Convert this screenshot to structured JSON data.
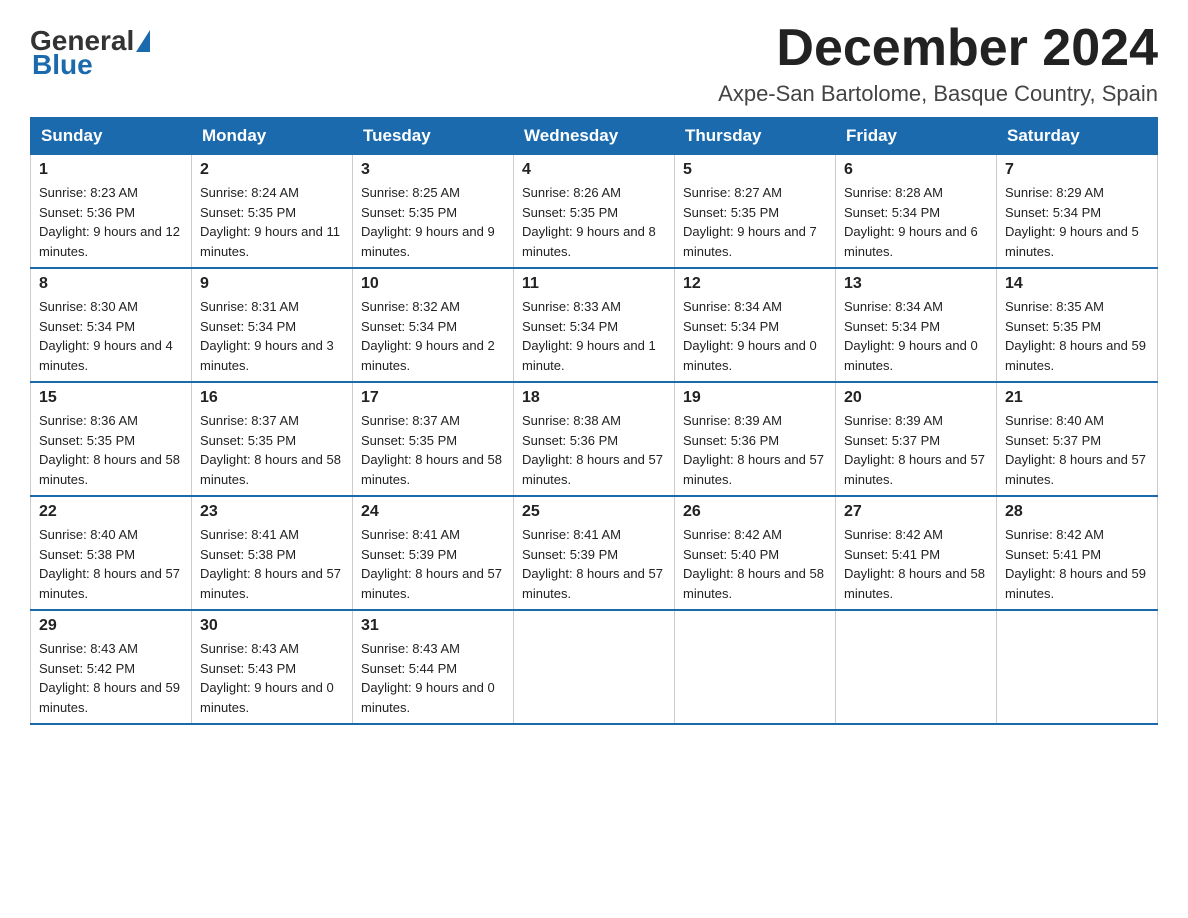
{
  "logo": {
    "general": "General",
    "blue": "Blue"
  },
  "header": {
    "title": "December 2024",
    "location": "Axpe-San Bartolome, Basque Country, Spain"
  },
  "days_of_week": [
    "Sunday",
    "Monday",
    "Tuesday",
    "Wednesday",
    "Thursday",
    "Friday",
    "Saturday"
  ],
  "weeks": [
    [
      {
        "day": "1",
        "sunrise": "8:23 AM",
        "sunset": "5:36 PM",
        "daylight": "9 hours and 12 minutes."
      },
      {
        "day": "2",
        "sunrise": "8:24 AM",
        "sunset": "5:35 PM",
        "daylight": "9 hours and 11 minutes."
      },
      {
        "day": "3",
        "sunrise": "8:25 AM",
        "sunset": "5:35 PM",
        "daylight": "9 hours and 9 minutes."
      },
      {
        "day": "4",
        "sunrise": "8:26 AM",
        "sunset": "5:35 PM",
        "daylight": "9 hours and 8 minutes."
      },
      {
        "day": "5",
        "sunrise": "8:27 AM",
        "sunset": "5:35 PM",
        "daylight": "9 hours and 7 minutes."
      },
      {
        "day": "6",
        "sunrise": "8:28 AM",
        "sunset": "5:34 PM",
        "daylight": "9 hours and 6 minutes."
      },
      {
        "day": "7",
        "sunrise": "8:29 AM",
        "sunset": "5:34 PM",
        "daylight": "9 hours and 5 minutes."
      }
    ],
    [
      {
        "day": "8",
        "sunrise": "8:30 AM",
        "sunset": "5:34 PM",
        "daylight": "9 hours and 4 minutes."
      },
      {
        "day": "9",
        "sunrise": "8:31 AM",
        "sunset": "5:34 PM",
        "daylight": "9 hours and 3 minutes."
      },
      {
        "day": "10",
        "sunrise": "8:32 AM",
        "sunset": "5:34 PM",
        "daylight": "9 hours and 2 minutes."
      },
      {
        "day": "11",
        "sunrise": "8:33 AM",
        "sunset": "5:34 PM",
        "daylight": "9 hours and 1 minute."
      },
      {
        "day": "12",
        "sunrise": "8:34 AM",
        "sunset": "5:34 PM",
        "daylight": "9 hours and 0 minutes."
      },
      {
        "day": "13",
        "sunrise": "8:34 AM",
        "sunset": "5:34 PM",
        "daylight": "9 hours and 0 minutes."
      },
      {
        "day": "14",
        "sunrise": "8:35 AM",
        "sunset": "5:35 PM",
        "daylight": "8 hours and 59 minutes."
      }
    ],
    [
      {
        "day": "15",
        "sunrise": "8:36 AM",
        "sunset": "5:35 PM",
        "daylight": "8 hours and 58 minutes."
      },
      {
        "day": "16",
        "sunrise": "8:37 AM",
        "sunset": "5:35 PM",
        "daylight": "8 hours and 58 minutes."
      },
      {
        "day": "17",
        "sunrise": "8:37 AM",
        "sunset": "5:35 PM",
        "daylight": "8 hours and 58 minutes."
      },
      {
        "day": "18",
        "sunrise": "8:38 AM",
        "sunset": "5:36 PM",
        "daylight": "8 hours and 57 minutes."
      },
      {
        "day": "19",
        "sunrise": "8:39 AM",
        "sunset": "5:36 PM",
        "daylight": "8 hours and 57 minutes."
      },
      {
        "day": "20",
        "sunrise": "8:39 AM",
        "sunset": "5:37 PM",
        "daylight": "8 hours and 57 minutes."
      },
      {
        "day": "21",
        "sunrise": "8:40 AM",
        "sunset": "5:37 PM",
        "daylight": "8 hours and 57 minutes."
      }
    ],
    [
      {
        "day": "22",
        "sunrise": "8:40 AM",
        "sunset": "5:38 PM",
        "daylight": "8 hours and 57 minutes."
      },
      {
        "day": "23",
        "sunrise": "8:41 AM",
        "sunset": "5:38 PM",
        "daylight": "8 hours and 57 minutes."
      },
      {
        "day": "24",
        "sunrise": "8:41 AM",
        "sunset": "5:39 PM",
        "daylight": "8 hours and 57 minutes."
      },
      {
        "day": "25",
        "sunrise": "8:41 AM",
        "sunset": "5:39 PM",
        "daylight": "8 hours and 57 minutes."
      },
      {
        "day": "26",
        "sunrise": "8:42 AM",
        "sunset": "5:40 PM",
        "daylight": "8 hours and 58 minutes."
      },
      {
        "day": "27",
        "sunrise": "8:42 AM",
        "sunset": "5:41 PM",
        "daylight": "8 hours and 58 minutes."
      },
      {
        "day": "28",
        "sunrise": "8:42 AM",
        "sunset": "5:41 PM",
        "daylight": "8 hours and 59 minutes."
      }
    ],
    [
      {
        "day": "29",
        "sunrise": "8:43 AM",
        "sunset": "5:42 PM",
        "daylight": "8 hours and 59 minutes."
      },
      {
        "day": "30",
        "sunrise": "8:43 AM",
        "sunset": "5:43 PM",
        "daylight": "9 hours and 0 minutes."
      },
      {
        "day": "31",
        "sunrise": "8:43 AM",
        "sunset": "5:44 PM",
        "daylight": "9 hours and 0 minutes."
      },
      null,
      null,
      null,
      null
    ]
  ],
  "labels": {
    "sunrise": "Sunrise:",
    "sunset": "Sunset:",
    "daylight": "Daylight:"
  }
}
